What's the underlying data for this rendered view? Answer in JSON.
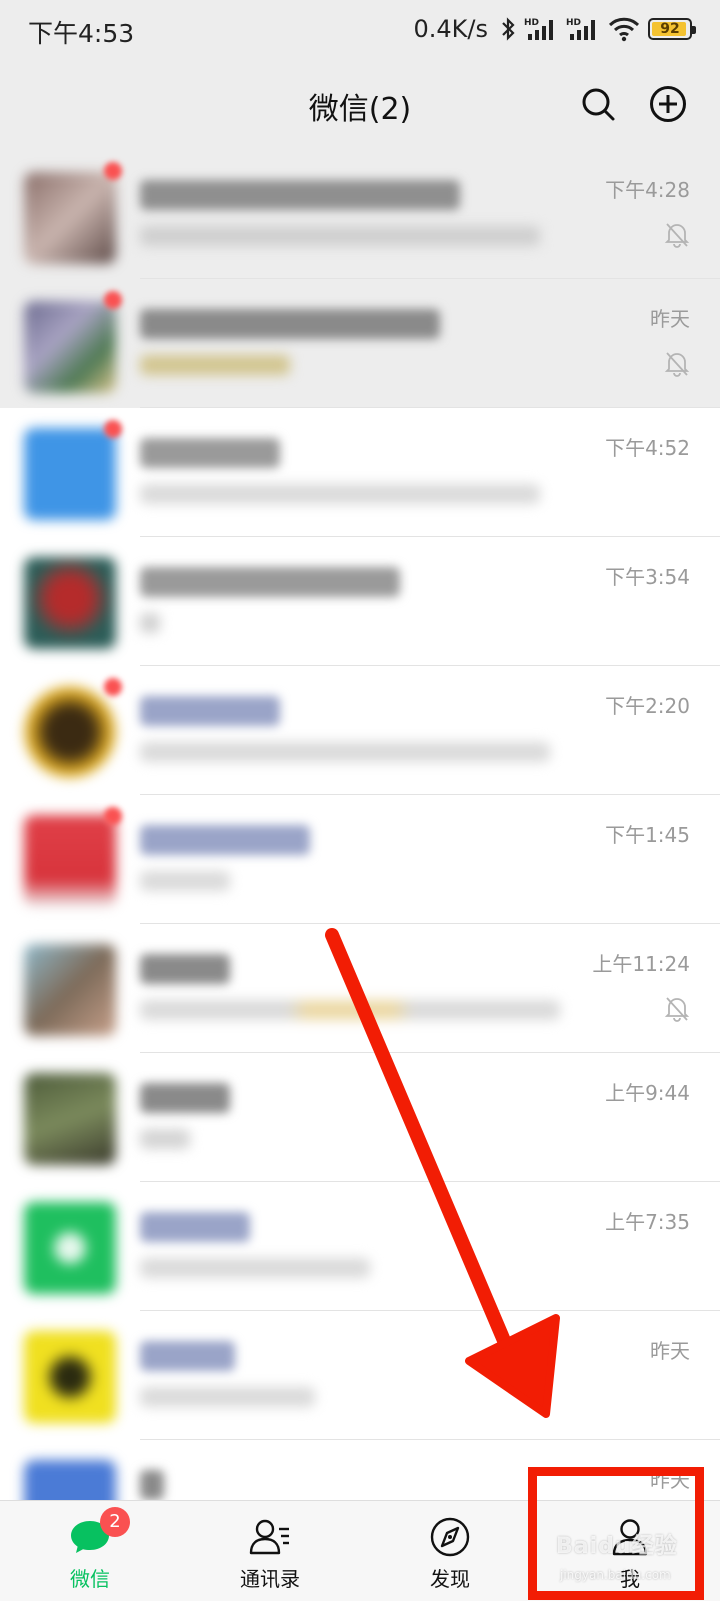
{
  "status_bar": {
    "time": "下午4:53",
    "net_speed": "0.4K/s",
    "battery": "92",
    "battery_color": "#f4c231"
  },
  "header": {
    "title": "微信(2)",
    "search_icon": "search-icon",
    "add_icon": "plus-circle-icon"
  },
  "chats": [
    {
      "time": "下午4:28",
      "muted": true
    },
    {
      "time": "昨天",
      "muted": true
    },
    {
      "time": "下午4:52",
      "muted": false
    },
    {
      "time": "下午3:54",
      "muted": false
    },
    {
      "time": "下午2:20",
      "muted": false
    },
    {
      "time": "下午1:45",
      "muted": false
    },
    {
      "time": "上午11:24",
      "muted": true
    },
    {
      "time": "上午9:44",
      "muted": false
    },
    {
      "time": "上午7:35",
      "muted": false
    },
    {
      "time": "昨天",
      "muted": false
    },
    {
      "time": "昨天",
      "muted": false
    }
  ],
  "tabbar": {
    "tabs": [
      {
        "label": "微信",
        "icon": "chat-bubble-icon",
        "badge": "2",
        "active": true
      },
      {
        "label": "通讯录",
        "icon": "contacts-icon",
        "active": false
      },
      {
        "label": "发现",
        "icon": "compass-icon",
        "active": false
      },
      {
        "label": "我",
        "icon": "person-icon",
        "active": false
      }
    ]
  },
  "colors": {
    "accent_green": "#07c160",
    "badge_red": "#fa5151",
    "annotation_red": "#f21d04",
    "header_bg": "#ededed"
  },
  "watermark": {
    "brand": "Baidu经验",
    "url": "jingyan.baidu.com"
  }
}
